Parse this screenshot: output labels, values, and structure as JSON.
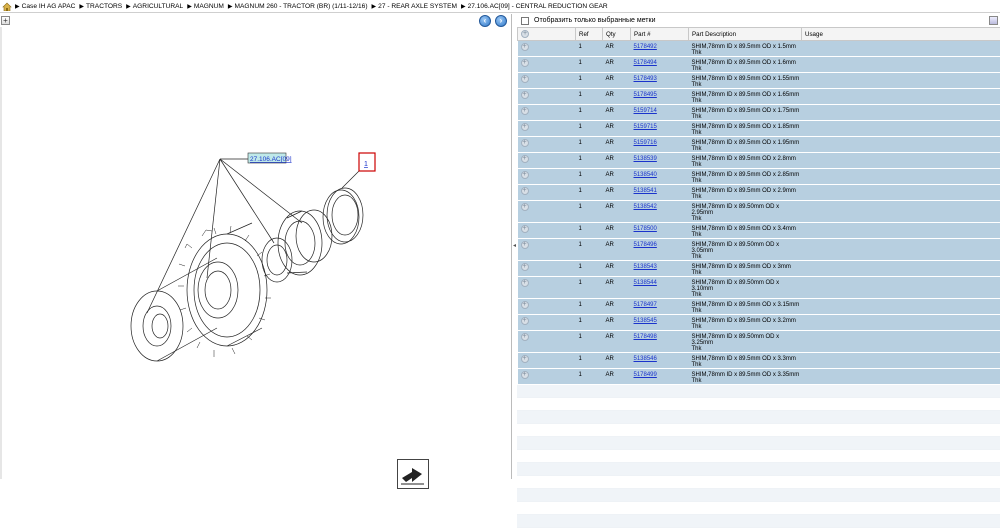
{
  "breadcrumb": [
    "Case IH AG APAC",
    "TRACTORS",
    "AGRICULTURAL",
    "MAGNUM",
    "MAGNUM 260 - TRACTOR (BR) (1/11-12/16)",
    "27 - REAR AXLE SYSTEM",
    "27.106.AC[09] - CENTRAL REDUCTION GEAR"
  ],
  "diagram": {
    "callout_label": "27.106.AC[09]",
    "ref_marker": "1"
  },
  "filter": {
    "label": "Отобразить только выбранные метки"
  },
  "table": {
    "headers": {
      "ref": "Ref",
      "qty": "Qty",
      "part": "Part #",
      "desc": "Part Description",
      "usage": "Usage"
    },
    "rows": [
      {
        "ref": "1",
        "qty": "AR",
        "part": "5178492",
        "desc": "SHIM,78mm ID x 89.5mm OD x 1.5mm Thk",
        "desc2": ""
      },
      {
        "ref": "1",
        "qty": "AR",
        "part": "5178494",
        "desc": "SHIM,78mm ID x 89.5mm OD x 1.6mm Thk",
        "desc2": ""
      },
      {
        "ref": "1",
        "qty": "AR",
        "part": "5178493",
        "desc": "SHIM,78mm ID x 89.5mm OD x 1.55mm Thk",
        "desc2": ""
      },
      {
        "ref": "1",
        "qty": "AR",
        "part": "5178495",
        "desc": "SHIM,78mm ID x 89.5mm OD x 1.65mm Thk",
        "desc2": ""
      },
      {
        "ref": "1",
        "qty": "AR",
        "part": "5159714",
        "desc": "SHIM,78mm ID x 89.5mm OD x 1.75mm Thk",
        "desc2": ""
      },
      {
        "ref": "1",
        "qty": "AR",
        "part": "5159715",
        "desc": "SHIM,78mm ID x 89.5mm OD x 1.85mm Thk",
        "desc2": ""
      },
      {
        "ref": "1",
        "qty": "AR",
        "part": "5159716",
        "desc": "SHIM,78mm ID x 89.5mm OD x 1.95mm Thk",
        "desc2": ""
      },
      {
        "ref": "1",
        "qty": "AR",
        "part": "5138539",
        "desc": "SHIM,78mm ID x 89.5mm OD x 2.8mm Thk",
        "desc2": ""
      },
      {
        "ref": "1",
        "qty": "AR",
        "part": "5138540",
        "desc": "SHIM,78mm ID x 89.5mm OD x 2.85mm Thk",
        "desc2": ""
      },
      {
        "ref": "1",
        "qty": "AR",
        "part": "5138541",
        "desc": "SHIM,78mm ID x 89.5mm OD x 2.9mm Thk",
        "desc2": ""
      },
      {
        "ref": "1",
        "qty": "AR",
        "part": "5138542",
        "desc": "SHIM,78mm ID x 89.50mm OD x 2.95mm",
        "desc2": "Thk"
      },
      {
        "ref": "1",
        "qty": "AR",
        "part": "5178500",
        "desc": "SHIM,78mm ID x 89.5mm OD x 3.4mm Thk",
        "desc2": ""
      },
      {
        "ref": "1",
        "qty": "AR",
        "part": "5178496",
        "desc": "SHIM,78mm ID x 89.50mm OD x 3.05mm",
        "desc2": "Thk"
      },
      {
        "ref": "1",
        "qty": "AR",
        "part": "5138543",
        "desc": "SHIM,78mm ID x 89.5mm OD x 3mm Thk",
        "desc2": ""
      },
      {
        "ref": "1",
        "qty": "AR",
        "part": "5138544",
        "desc": "SHIM,78mm ID x 89.50mm OD x 3.10mm",
        "desc2": "Thk"
      },
      {
        "ref": "1",
        "qty": "AR",
        "part": "5178497",
        "desc": "SHIM,78mm ID x 89.5mm OD x 3.15mm Thk",
        "desc2": ""
      },
      {
        "ref": "1",
        "qty": "AR",
        "part": "5138545",
        "desc": "SHIM,78mm ID x 89.5mm OD x 3.2mm Thk",
        "desc2": ""
      },
      {
        "ref": "1",
        "qty": "AR",
        "part": "5178498",
        "desc": "SHIM,78mm ID x 89.50mm OD x 3.25mm",
        "desc2": "Thk"
      },
      {
        "ref": "1",
        "qty": "AR",
        "part": "5138546",
        "desc": "SHIM,78mm ID x 89.5mm OD x 3.3mm Thk",
        "desc2": ""
      },
      {
        "ref": "1",
        "qty": "AR",
        "part": "5178499",
        "desc": "SHIM,78mm ID x 89.5mm OD x 3.35mm Thk",
        "desc2": ""
      }
    ]
  },
  "colors": {
    "row_bg": "#b7cfe0",
    "link": "#1a33cc",
    "callout_bg": "#bfe9e9",
    "marker_border": "#cc0000"
  },
  "icons": [
    "home-icon",
    "expand-icon",
    "back-icon",
    "forward-icon",
    "row-expand-icon",
    "export-arrow-icon"
  ]
}
